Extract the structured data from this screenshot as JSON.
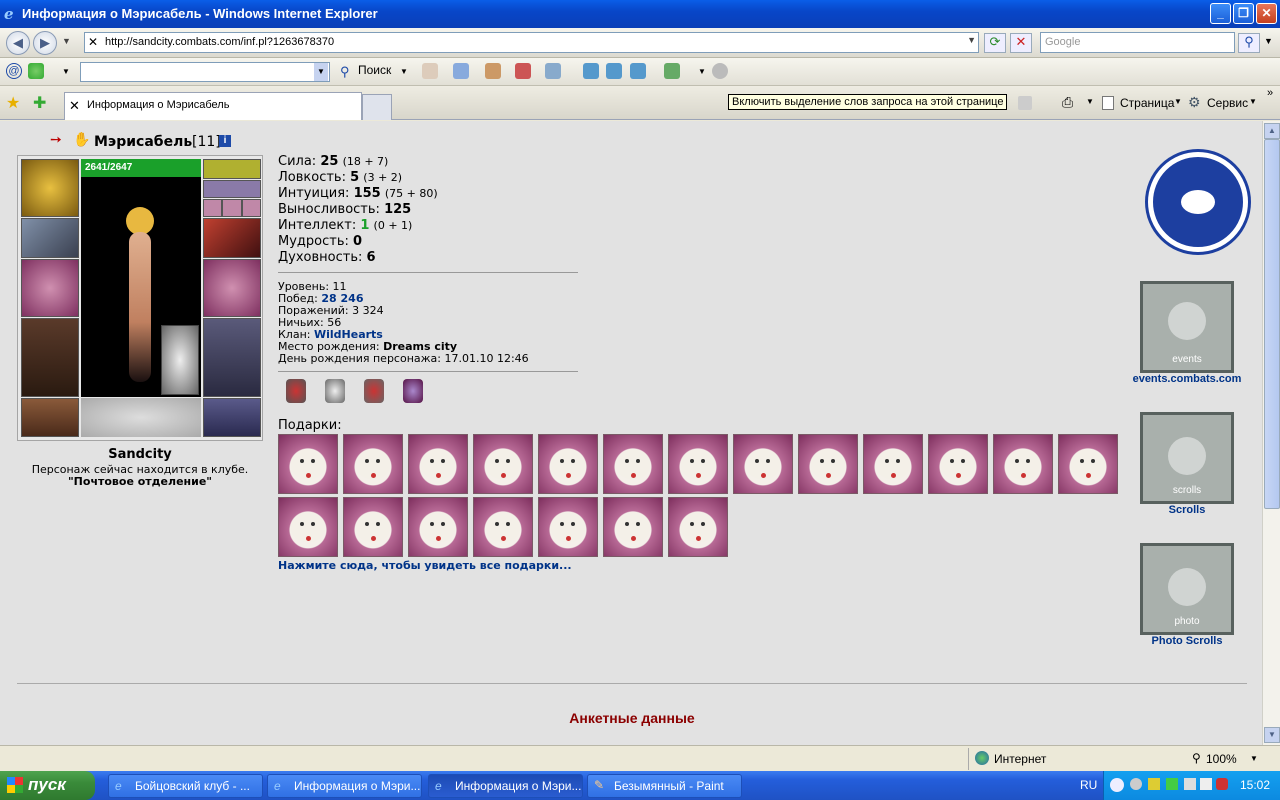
{
  "window": {
    "title": "Информация о Мэрисабель - Windows Internet Explorer"
  },
  "address": {
    "url": "http://sandcity.combats.com/inf.pl?1263678370",
    "search_placeholder": "Google"
  },
  "toolbar2": {
    "search_label": "Поиск"
  },
  "tabs": {
    "active_title": "Информация о Мэрисабель",
    "tooltip": "Включить выделение слов запроса на этой странице",
    "page_menu": "Страница",
    "tools_menu": "Сервис"
  },
  "character": {
    "name": "Мэрисабель",
    "level": "[11]",
    "hp": "2641/2647",
    "city": "Sandcity",
    "location_text": "Персонаж сейчас находится в клубе.",
    "location_name": "\"Почтовое отделение\""
  },
  "stats": [
    {
      "label": "Сила:",
      "value": "25",
      "detail": "(18 + 7)"
    },
    {
      "label": "Ловкость:",
      "value": "5",
      "detail": "(3 + 2)"
    },
    {
      "label": "Интуиция:",
      "value": "155",
      "detail": "(75 + 80)"
    },
    {
      "label": "Выносливость:",
      "value": "125",
      "detail": ""
    },
    {
      "label": "Интеллект:",
      "value": "1",
      "detail": "(0 + 1)"
    },
    {
      "label": "Мудрость:",
      "value": "0",
      "detail": ""
    },
    {
      "label": "Духовность:",
      "value": "6",
      "detail": ""
    }
  ],
  "info": {
    "level_label": "Уровень:",
    "level": "11",
    "wins_label": "Побед:",
    "wins": "28 246",
    "losses_label": "Поражений:",
    "losses": "3 324",
    "draws_label": "Ничьих:",
    "draws": "56",
    "clan_label": "Клан:",
    "clan": "WildHearts",
    "birthplace_label": "Место рождения:",
    "birthplace": "Dreams city",
    "birthday_label": "День рождения персонажа:",
    "birthday": "17.01.10 12:46"
  },
  "gifts": {
    "label": "Подарки:",
    "link": "Нажмите сюда, чтобы увидеть все подарки..."
  },
  "side": {
    "events_text": "events",
    "events_link": "events.combats.com",
    "scrolls_text": "scrolls",
    "scrolls_link": "Scrolls",
    "photo_text": "photo",
    "photo_link": "Photo Scrolls"
  },
  "section_title": "Анкетные данные",
  "status": {
    "zone": "Интернет",
    "zoom": "100%"
  },
  "taskbar": {
    "start": "пуск",
    "tasks": [
      "Бойцовский клуб - ...",
      "Информация о Мэри...",
      "Информация о Мэри...",
      "Безымянный - Paint"
    ],
    "lang": "RU",
    "clock": "15:02"
  },
  "colors": {
    "accent_link": "#003388",
    "section_title": "#8b0000",
    "hp_bar": "#1aa02a"
  }
}
